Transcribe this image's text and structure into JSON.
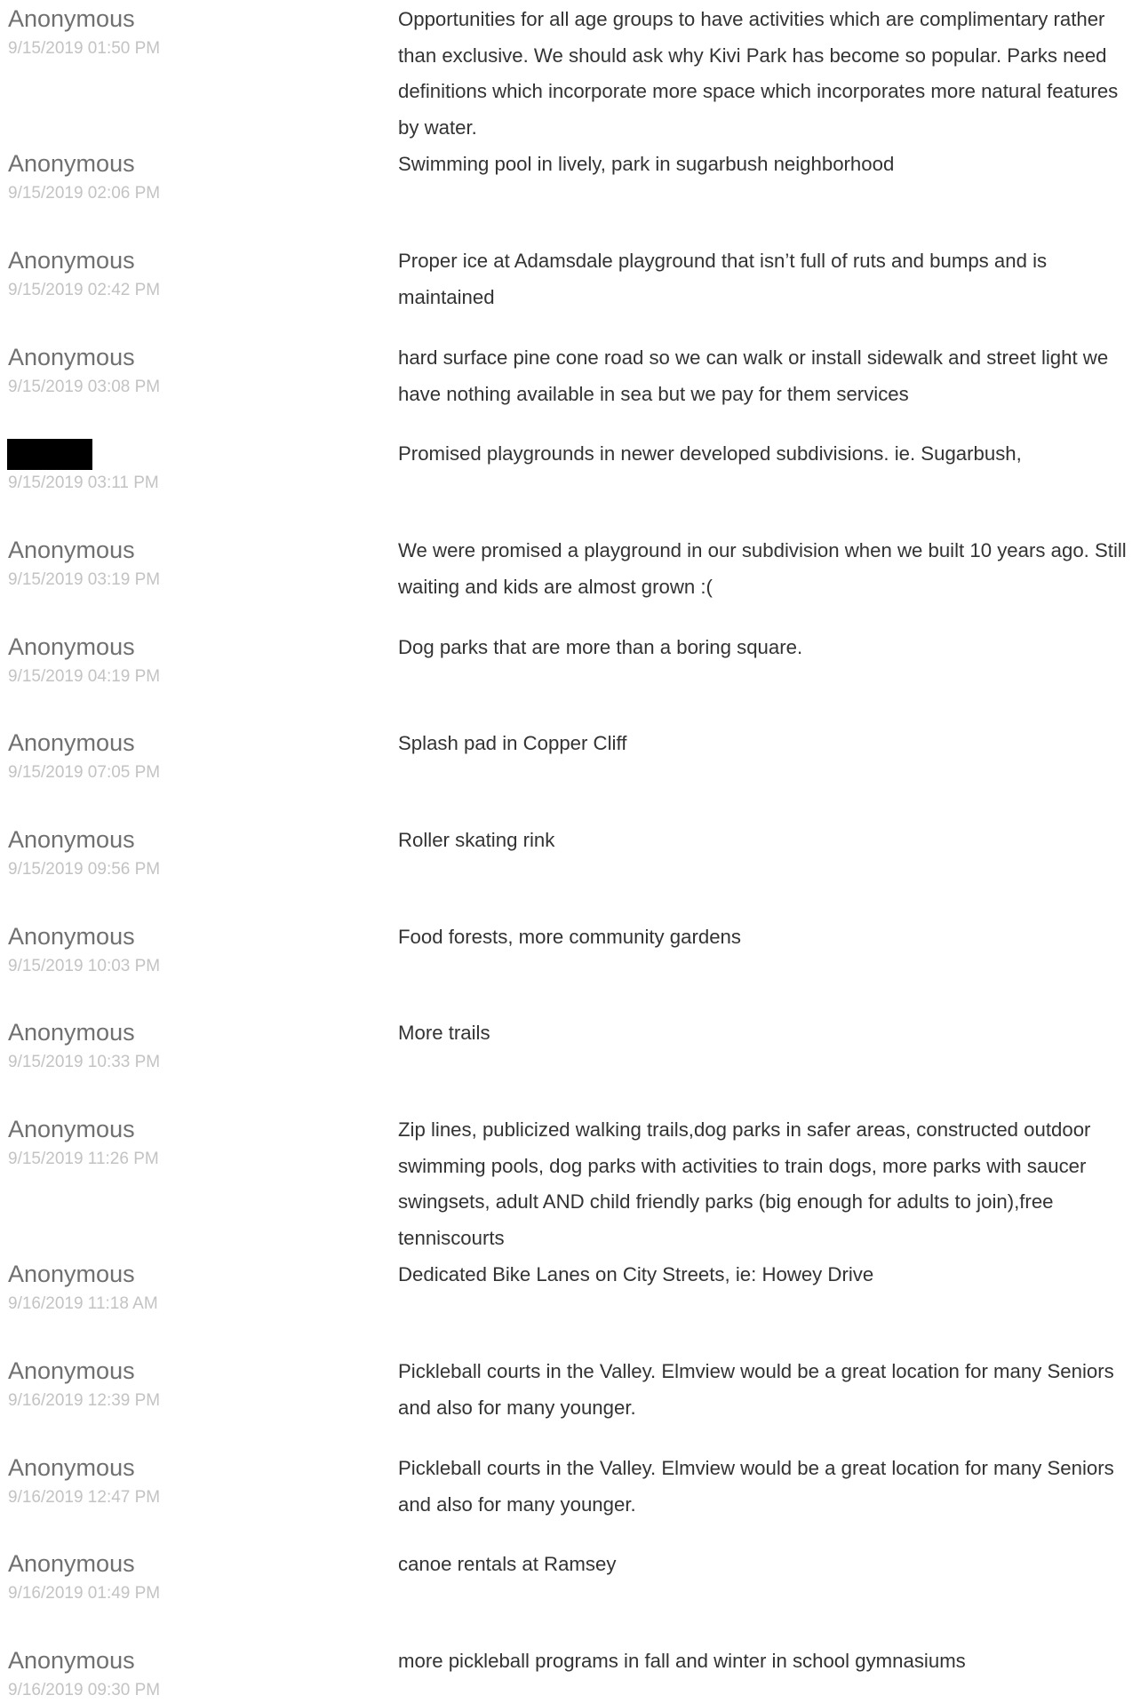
{
  "responses": [
    {
      "author": "Anonymous",
      "timestamp": "9/15/2019 01:50 PM",
      "text": "Opportunities for all age groups to have activities which are complimentary rather than exclusive. We should ask why Kivi Park has become so popular. Parks need definitions which incorporate more space which incorporates more natural features by water."
    },
    {
      "author": "Anonymous",
      "timestamp": "9/15/2019 02:06 PM",
      "text": "Swimming pool in lively, park in sugarbush neighborhood"
    },
    {
      "author": "Anonymous",
      "timestamp": "9/15/2019 02:42 PM",
      "text": "Proper ice at Adamsdale playground that isn’t full of ruts and bumps and is maintained"
    },
    {
      "author": "Anonymous",
      "timestamp": "9/15/2019 03:08 PM",
      "text": "hard surface pine cone road so we can walk or install sidewalk and street light we have nothing available in sea but we pay for them services"
    },
    {
      "author": "",
      "redacted": true,
      "timestamp": "9/15/2019 03:11 PM",
      "text": "Promised playgrounds in newer developed subdivisions. ie. Sugarbush,"
    },
    {
      "author": "Anonymous",
      "timestamp": "9/15/2019 03:19 PM",
      "text": "We were promised a playground in our subdivision when we built 10 years ago. Still waiting and kids are almost grown :("
    },
    {
      "author": "Anonymous",
      "timestamp": "9/15/2019 04:19 PM",
      "text": "Dog parks that are more than a boring square."
    },
    {
      "author": "Anonymous",
      "timestamp": "9/15/2019 07:05 PM",
      "text": "Splash pad in Copper Cliff"
    },
    {
      "author": "Anonymous",
      "timestamp": "9/15/2019 09:56 PM",
      "text": "Roller skating rink"
    },
    {
      "author": "Anonymous",
      "timestamp": "9/15/2019 10:03 PM",
      "text": "Food forests, more community gardens"
    },
    {
      "author": "Anonymous",
      "timestamp": "9/15/2019 10:33 PM",
      "text": "More trails"
    },
    {
      "author": "Anonymous",
      "timestamp": "9/15/2019 11:26 PM",
      "text": "Zip lines, publicized walking trails,dog parks in safer areas, constructed outdoor swimming pools, dog parks with activities to train dogs, more parks with saucer swingsets, adult AND child friendly parks (big enough for adults to join),free tenniscourts"
    },
    {
      "author": "Anonymous",
      "timestamp": "9/16/2019 11:18 AM",
      "text": "Dedicated Bike Lanes on City Streets, ie: Howey Drive"
    },
    {
      "author": "Anonymous",
      "timestamp": "9/16/2019 12:39 PM",
      "text": "Pickleball courts in the Valley. Elmview would be a great location for many Seniors and also for many younger."
    },
    {
      "author": "Anonymous",
      "timestamp": "9/16/2019 12:47 PM",
      "text": "Pickleball courts in the Valley. Elmview would be a great location for many Seniors and also for many younger."
    },
    {
      "author": "Anonymous",
      "timestamp": "9/16/2019 01:49 PM",
      "text": "canoe rentals at Ramsey"
    },
    {
      "author": "Anonymous",
      "timestamp": "9/16/2019 09:30 PM",
      "text": "more pickleball programs in fall and winter in school gymnasiums"
    }
  ]
}
